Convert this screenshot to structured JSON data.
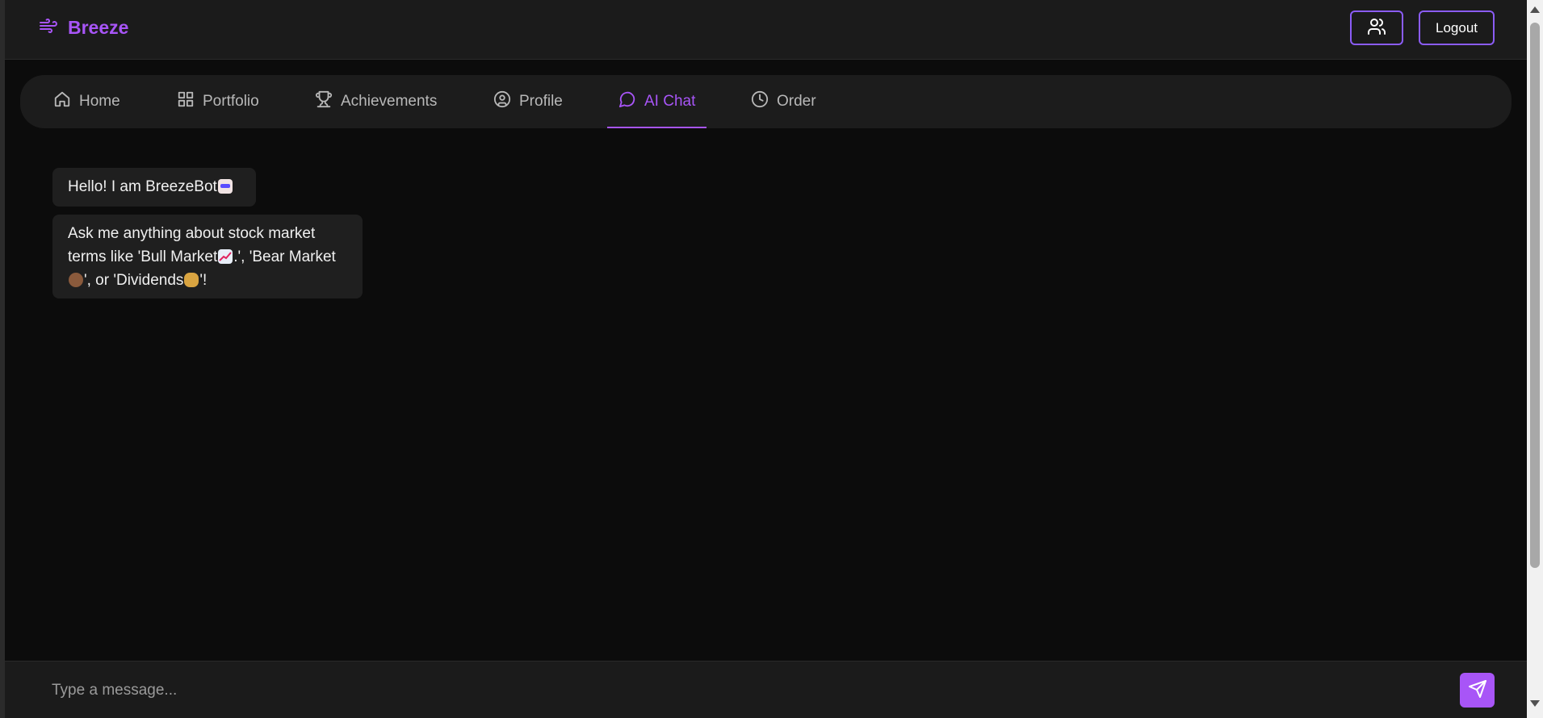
{
  "app": {
    "brand_name": "Breeze",
    "brand_icon": "wind-icon",
    "accent_color": "#a855f7"
  },
  "header": {
    "users_button_icon": "users-icon",
    "logout_label": "Logout"
  },
  "nav": {
    "items": [
      {
        "label": "Home",
        "icon": "home-icon",
        "active": false
      },
      {
        "label": "Portfolio",
        "icon": "grid-icon",
        "active": false
      },
      {
        "label": "Achievements",
        "icon": "trophy-icon",
        "active": false
      },
      {
        "label": "Profile",
        "icon": "user-circle-icon",
        "active": false
      },
      {
        "label": "AI Chat",
        "icon": "message-circle-icon",
        "active": true
      },
      {
        "label": "Order",
        "icon": "clock-icon",
        "active": false
      }
    ]
  },
  "chat": {
    "messages": [
      {
        "sender": "bot",
        "text": "Hello! I am BreezeBot",
        "emoji": "robot-emoji"
      },
      {
        "sender": "bot",
        "line1": "Ask me anything about stock market",
        "line2_a": "terms like 'Bull Market",
        "line2_b": ".', 'Bear Market",
        "line3_a": "', or 'Dividends",
        "line3_b": "'!",
        "emojis": [
          "chart-increasing-emoji",
          "bear-emoji",
          "money-bag-emoji"
        ]
      }
    ]
  },
  "input": {
    "placeholder": "Type a message...",
    "value": "",
    "send_icon": "send-icon"
  }
}
